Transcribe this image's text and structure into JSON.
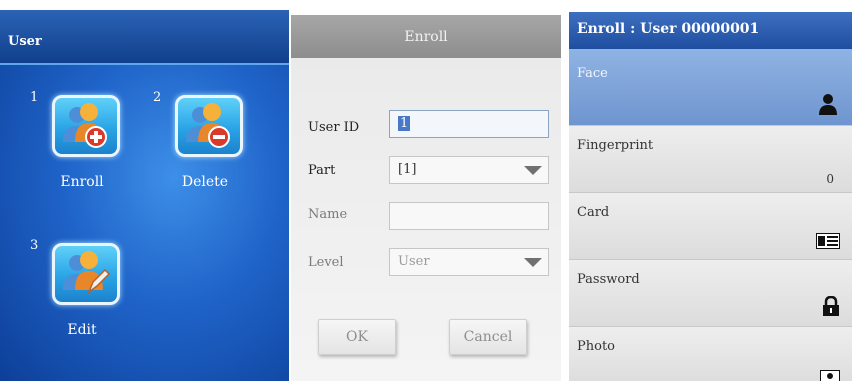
{
  "user_menu": {
    "title": "User",
    "items": [
      {
        "number": "1",
        "label": "Enroll",
        "icon": "add-user-icon"
      },
      {
        "number": "2",
        "label": "Delete",
        "icon": "remove-user-icon"
      },
      {
        "number": "3",
        "label": "Edit",
        "icon": "edit-user-icon"
      }
    ]
  },
  "enroll_form": {
    "title": "Enroll",
    "fields": {
      "user_id": {
        "label": "User ID",
        "value": "1"
      },
      "part": {
        "label": "Part",
        "value": "[1]"
      },
      "name": {
        "label": "Name",
        "value": ""
      },
      "level": {
        "label": "Level",
        "value": "User"
      }
    },
    "ok_label": "OK",
    "cancel_label": "Cancel"
  },
  "enroll_detail": {
    "title": "Enroll : User 00000001",
    "rows": [
      {
        "label": "Face",
        "icon": "person-icon",
        "selected": true
      },
      {
        "label": "Fingerprint",
        "value": "0"
      },
      {
        "label": "Card",
        "icon": "id-card-icon"
      },
      {
        "label": "Password",
        "icon": "lock-icon"
      },
      {
        "label": "Photo",
        "icon": "photo-icon"
      }
    ]
  },
  "colors": {
    "menu_bg": "#1f63c8",
    "tile_blue": "#2aa4e6",
    "detail_header": "#2a5bb0",
    "detail_selected": "#7fa4d9"
  }
}
